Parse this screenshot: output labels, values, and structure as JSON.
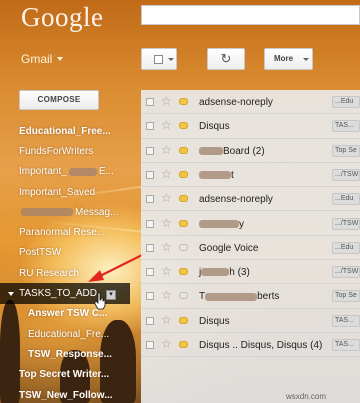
{
  "logo": "Google",
  "app_switch": "Gmail",
  "compose": "COMPOSE",
  "toolbar": {
    "refresh_icon": "↻",
    "more_label": "More"
  },
  "sidebar": {
    "items": [
      {
        "label": "Educational_Free..."
      },
      {
        "label": "FundsForWriters"
      },
      {
        "label_prefix": "Important_",
        "label_suffix": "E..."
      },
      {
        "label": "Important_Saved"
      },
      {
        "label_suffix": "Messag..."
      },
      {
        "label": "Paranormal Rese..."
      },
      {
        "label": "PostTSW"
      },
      {
        "label": "RU Research"
      },
      {
        "label": "TASKS_TO_ADD"
      },
      {
        "label": "Answer TSW C..."
      },
      {
        "label": "Educational_Fre..."
      },
      {
        "label": "TSW_Response..."
      },
      {
        "label": "Top Secret Writer..."
      },
      {
        "label": "TSW_New_Follow..."
      }
    ],
    "label_menu_glyph": "▾"
  },
  "emails": [
    {
      "sender": "adsense-noreply",
      "tag": "...Edu",
      "important": true
    },
    {
      "sender": "Disqus",
      "tag": "TAS...",
      "important": true
    },
    {
      "sender_suffix": "Board (2)",
      "tag": "Top Se",
      "important": true
    },
    {
      "sender_suffix": "t",
      "tag": ".../TSW",
      "important": true
    },
    {
      "sender": "adsense-noreply",
      "tag": "...Edu",
      "important": true
    },
    {
      "sender_suffix": "y",
      "tag": ".../TSW",
      "important": true
    },
    {
      "sender": "Google Voice",
      "tag": "...Edu",
      "important": false
    },
    {
      "sender_prefix": "j",
      "sender_suffix": "h (3)",
      "tag": ".../TSW",
      "important": true
    },
    {
      "sender_prefix": "T",
      "sender_suffix": "berts",
      "tag": "Top Se",
      "important": false
    },
    {
      "sender": "Disqus",
      "tag": "TAS...",
      "important": true
    },
    {
      "sender": "Disqus .. Disqus, Disqus (4)",
      "tag": "TAS...",
      "important": true
    }
  ],
  "watermark": "wsxdn.com",
  "colors": {
    "theme_orange": "#d98a2e",
    "nav_active_bg": "#000000",
    "important_marker": "#f3c544",
    "annotation_arrow": "#e3261c"
  }
}
